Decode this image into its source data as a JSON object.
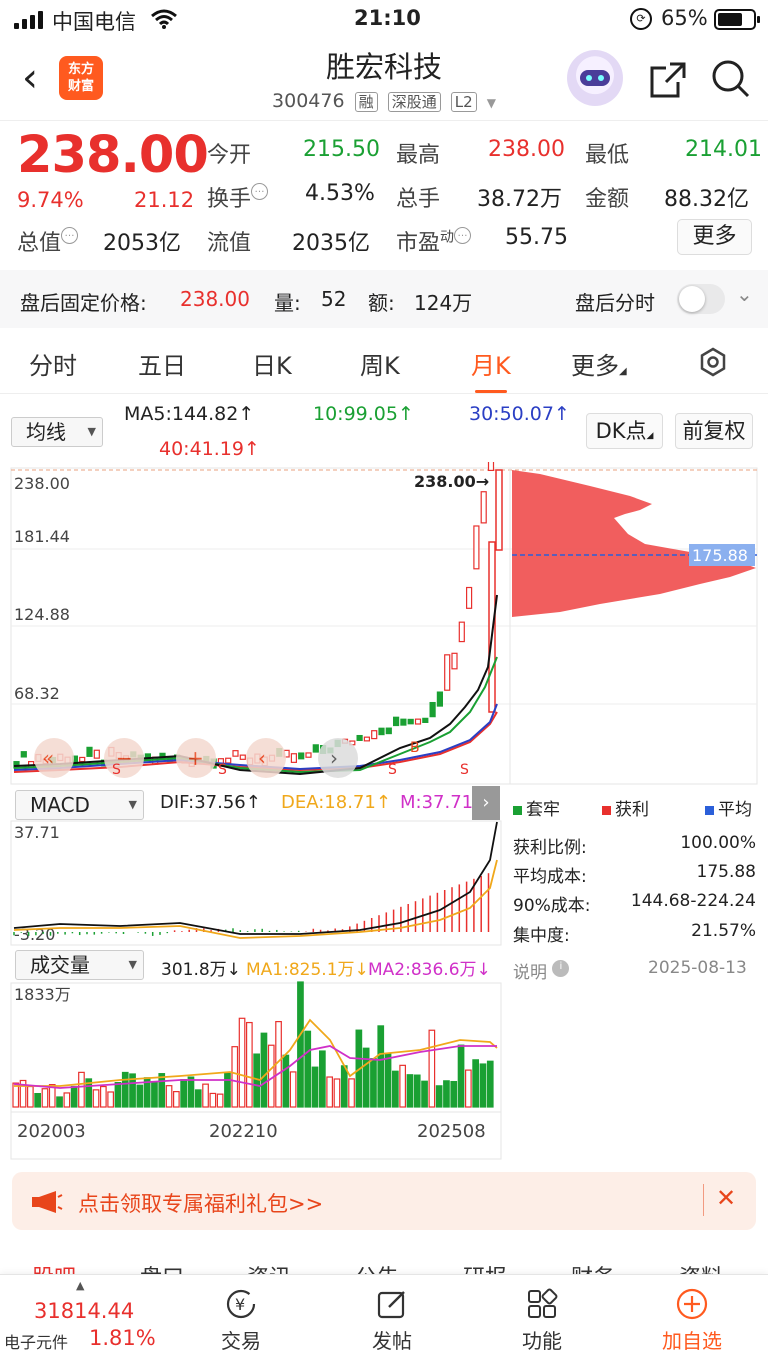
{
  "status": {
    "carrier": "中国电信",
    "time": "21:10",
    "battery": "65%"
  },
  "header": {
    "logo": "东方财富",
    "title": "胜宏科技",
    "code": "300476",
    "tags": [
      "融",
      "深股通",
      "L2"
    ]
  },
  "quote": {
    "price": "238.00",
    "pct": "9.74%",
    "change": "21.12",
    "open_label": "今开",
    "open": "215.50",
    "high_label": "最高",
    "high": "238.00",
    "low_label": "最低",
    "low": "214.01",
    "turnover_label": "换手",
    "turnover": "4.53%",
    "volume_label": "总手",
    "volume": "38.72万",
    "amount_label": "金额",
    "amount": "88.32亿",
    "mcap_label": "总值",
    "mcap": "2053亿",
    "float_label": "流值",
    "float": "2035亿",
    "pe_label": "市盈",
    "pe_sup": "动",
    "pe": "55.75",
    "more": "更多"
  },
  "afterhours": {
    "price_label": "盘后固定价格:",
    "price": "238.00",
    "vol_label": "量:",
    "vol": "52",
    "amt_label": "额:",
    "amt": "124万",
    "timeshare_label": "盘后分时"
  },
  "tabs": [
    "分时",
    "五日",
    "日K",
    "周K",
    "月K",
    "更多"
  ],
  "kline": {
    "ma_select": "均线",
    "ma5": "MA5:144.82↑",
    "ma10": "10:99.05↑",
    "ma30": "30:50.07↑",
    "ma40": "40:41.19↑",
    "dk_button": "DK点",
    "adj_button": "前复权",
    "max_label": "238.00→",
    "y_ticks": [
      "238.00",
      "181.44",
      "124.88",
      "68.32"
    ],
    "avg_cost_tag": "175.88"
  },
  "macd": {
    "select": "MACD",
    "dif": "DIF:37.56↑",
    "dea": "DEA:18.71↑",
    "m": "M:37.71↑",
    "top": "37.71",
    "bottom": "-3.20"
  },
  "volume": {
    "select": "成交量",
    "v": "301.8万↓",
    "ma1": "MA1:825.1万↓",
    "ma2": "MA2:836.6万↓",
    "top": "1833万",
    "dates": [
      "202003",
      "202210",
      "202508"
    ]
  },
  "chips": {
    "legend": [
      "套牢",
      "获利",
      "平均"
    ],
    "rows": [
      {
        "label": "获利比例:",
        "value": "100.00%"
      },
      {
        "label": "平均成本:",
        "value": "175.88"
      },
      {
        "label": "90%成本:",
        "value": "144.68-224.24"
      },
      {
        "label": "集中度:",
        "value": "21.57%"
      }
    ],
    "note": "说明",
    "date": "2025-08-13"
  },
  "banner": {
    "text": "点击领取专属福利礼包>>"
  },
  "sections": [
    "股吧",
    "盘口",
    "资讯",
    "公告",
    "研报",
    "财务",
    "资料"
  ],
  "index": {
    "value": "31814.44",
    "name": "电子元件",
    "pct": "1.81%"
  },
  "tabbar": [
    "交易",
    "发帖",
    "功能",
    "加自选"
  ],
  "colors": {
    "up": "#e8302d",
    "down": "#1aa033",
    "accent": "#ff5a1f"
  }
}
